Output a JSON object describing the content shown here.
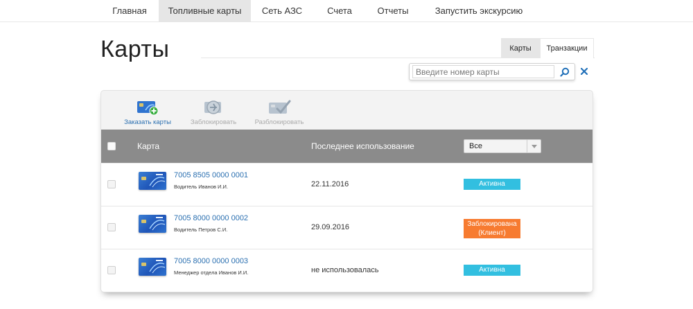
{
  "nav": {
    "items": [
      {
        "label": "Главная"
      },
      {
        "label": "Топливные карты"
      },
      {
        "label": "Сеть АЗС"
      },
      {
        "label": "Счета"
      },
      {
        "label": "Отчеты"
      },
      {
        "label": "Запустить экскурсию"
      }
    ],
    "active_index": 1
  },
  "page": {
    "title": "Карты"
  },
  "view_tabs": {
    "items": [
      {
        "label": "Карты"
      },
      {
        "label": "Транзакции"
      }
    ],
    "active_index": 0
  },
  "search": {
    "placeholder": "Введите номер карты",
    "value": ""
  },
  "toolbar": {
    "actions": [
      {
        "label": "Заказать карты",
        "enabled": true,
        "icon": "order-cards-icon"
      },
      {
        "label": "Заблокировать",
        "enabled": false,
        "icon": "block-card-icon"
      },
      {
        "label": "Разблокировать",
        "enabled": false,
        "icon": "unblock-card-icon"
      }
    ]
  },
  "table": {
    "headers": {
      "card": "Карта",
      "last_use": "Последнее использование"
    },
    "status_filter": {
      "selected": "Все"
    },
    "rows": [
      {
        "number": "7005 8505 0000 0001",
        "holder": "Водитель Иванов И.И.",
        "last_use": "22.11.2016",
        "status": "Активна",
        "status_kind": "active"
      },
      {
        "number": "7005 8000 0000 0002",
        "holder": "Водитель Петров С.И.",
        "last_use": "29.09.2016",
        "status_line1": "Заблокирована",
        "status_line2": "(Клиент)",
        "status_kind": "blocked"
      },
      {
        "number": "7005 8000 0000 0003",
        "holder": "Менеджер отдела Иванов И.И.",
        "last_use": "не использовалась",
        "status": "Активна",
        "status_kind": "active"
      }
    ]
  },
  "colors": {
    "accent_link": "#2a6fb0",
    "active_badge": "#32bfe0",
    "blocked_badge": "#f77b30",
    "table_header": "#8b8b8b"
  }
}
